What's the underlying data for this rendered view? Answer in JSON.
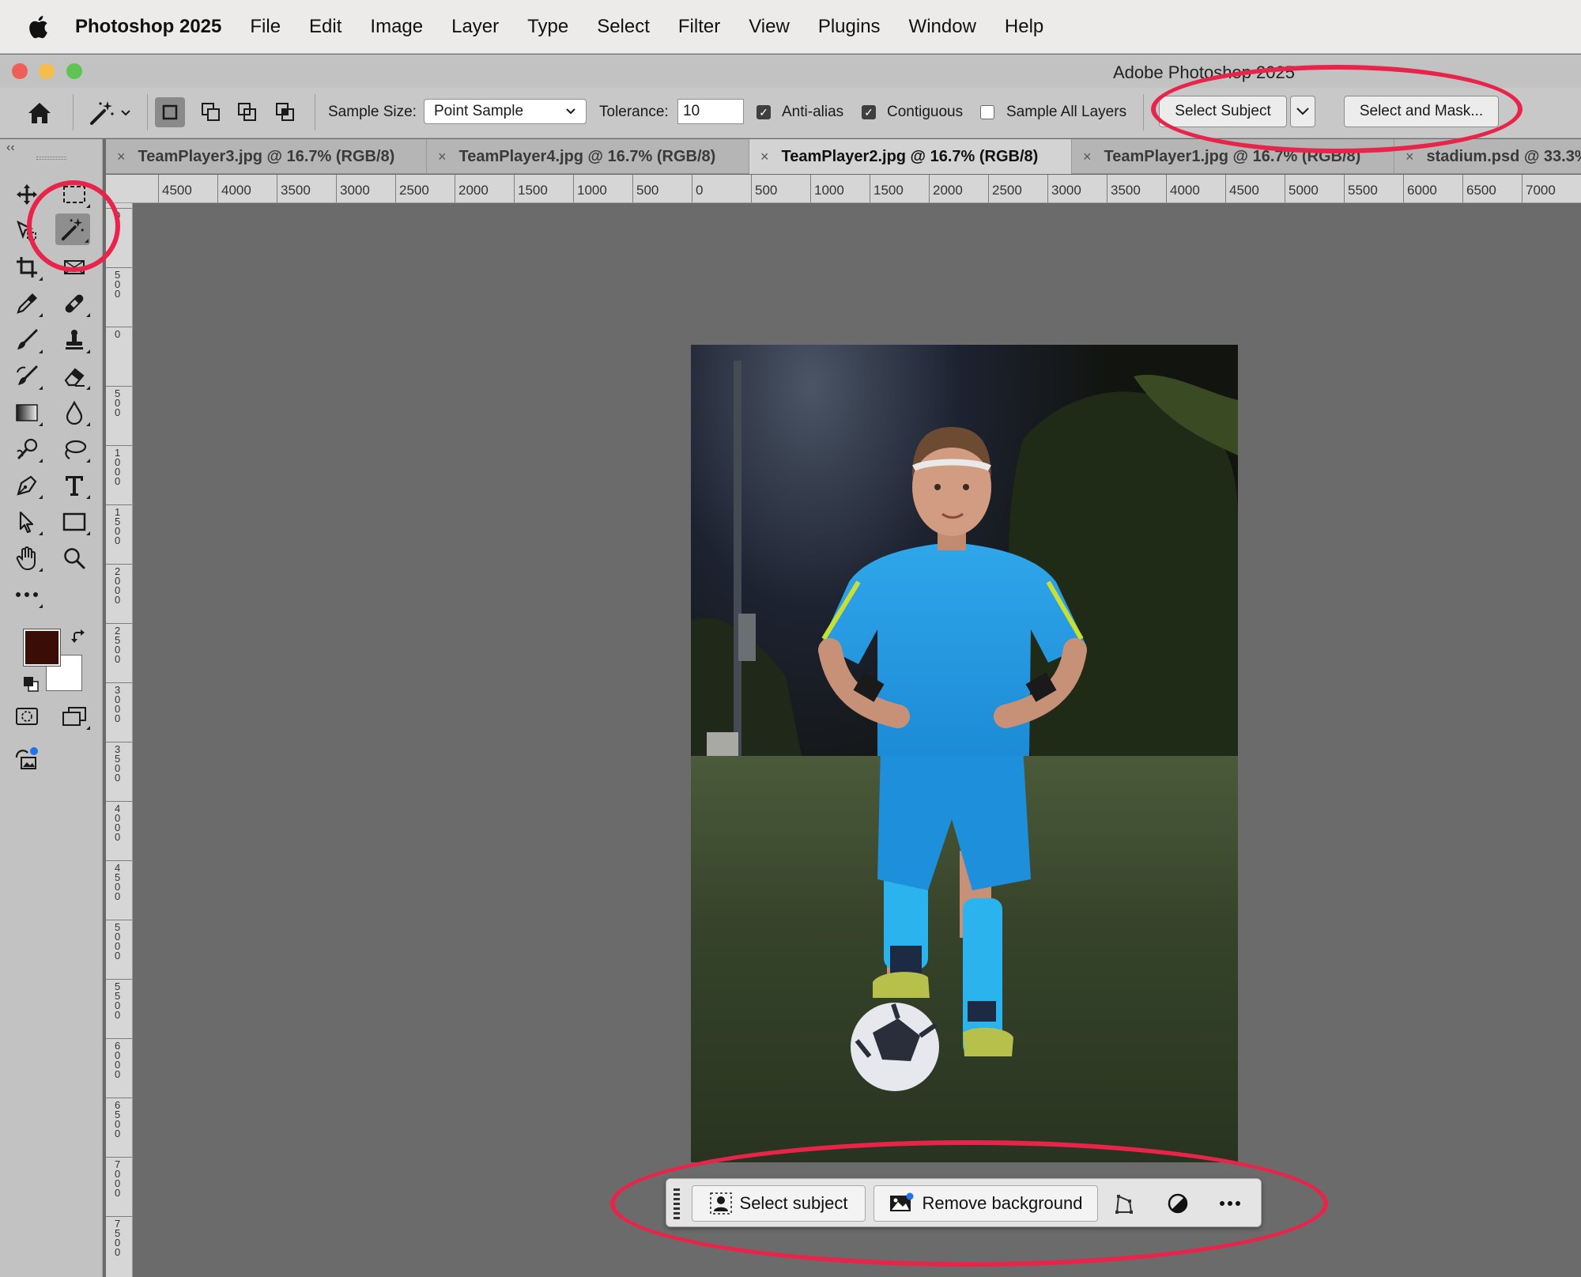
{
  "menubar": {
    "app_name": "Photoshop 2025",
    "items": [
      "File",
      "Edit",
      "Image",
      "Layer",
      "Type",
      "Select",
      "Filter",
      "View",
      "Plugins",
      "Window",
      "Help"
    ]
  },
  "window": {
    "title": "Adobe Photoshop 2025"
  },
  "options_bar": {
    "sample_size_label": "Sample Size:",
    "sample_size_value": "Point Sample",
    "tolerance_label": "Tolerance:",
    "tolerance_value": "10",
    "anti_alias_label": "Anti-alias",
    "anti_alias_checked": true,
    "contiguous_label": "Contiguous",
    "contiguous_checked": true,
    "sample_all_layers_label": "Sample All Layers",
    "sample_all_layers_checked": false,
    "select_subject_label": "Select Subject",
    "select_and_mask_label": "Select and Mask..."
  },
  "tabs": [
    {
      "label": "TeamPlayer3.jpg @ 16.7% (RGB/8)",
      "active": false
    },
    {
      "label": "TeamPlayer4.jpg @ 16.7% (RGB/8)",
      "active": false
    },
    {
      "label": "TeamPlayer2.jpg @ 16.7% (RGB/8)",
      "active": true
    },
    {
      "label": "TeamPlayer1.jpg @ 16.7% (RGB/8)",
      "active": false
    },
    {
      "label": "stadium.psd @ 33.3%",
      "active": false
    }
  ],
  "tab_close_glyph": "×",
  "ruler": {
    "horizontal": [
      "4500",
      "4000",
      "3500",
      "3000",
      "2500",
      "2000",
      "1500",
      "1000",
      "500",
      "0",
      "500",
      "1000",
      "1500",
      "2000",
      "2500",
      "3000",
      "3500",
      "4000",
      "4500",
      "5000",
      "5500",
      "6000",
      "6500",
      "7000"
    ],
    "vertical": [
      "0",
      "500",
      "0",
      "500",
      "1000",
      "1500",
      "2000",
      "2500",
      "3000",
      "3500",
      "4000",
      "4500",
      "5000",
      "5500",
      "6000",
      "6500",
      "7000",
      "7500"
    ]
  },
  "colors": {
    "foreground": "#3a0d07",
    "background": "#ffffff",
    "annotation": "#e8244a"
  },
  "taskbar": {
    "select_subject_label": "Select subject",
    "remove_background_label": "Remove background"
  }
}
